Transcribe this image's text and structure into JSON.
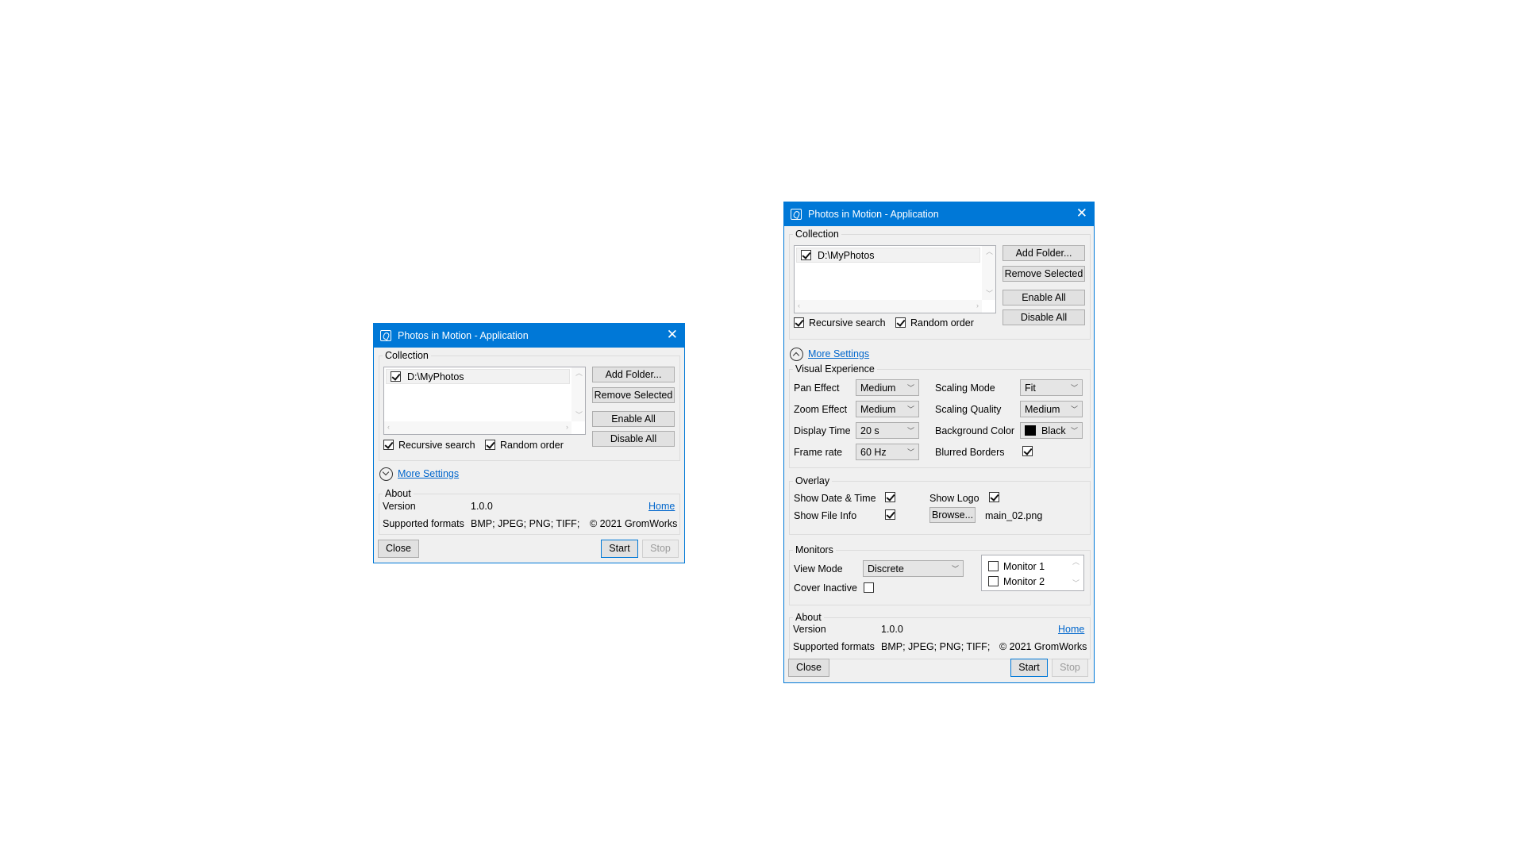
{
  "small_window": {
    "title": "Photos in Motion - Application",
    "close_glyph": "✕",
    "collection": {
      "label": "Collection",
      "folders": [
        {
          "path": "D:\\MyPhotos",
          "enabled": true
        }
      ],
      "add_folder": "Add Folder...",
      "remove_selected": "Remove Selected",
      "enable_all": "Enable All",
      "disable_all": "Disable All",
      "recursive_search": "Recursive search",
      "random_order": "Random order"
    },
    "more_settings": "More Settings",
    "about": {
      "label": "About",
      "version_label": "Version",
      "version_value": "1.0.0",
      "home_link": "Home",
      "formats_label": "Supported formats",
      "formats_value": "BMP; JPEG; PNG; TIFF;",
      "copyright": "© 2021 GromWorks"
    },
    "buttons": {
      "close": "Close",
      "start": "Start",
      "stop": "Stop"
    }
  },
  "large_window": {
    "title": "Photos in Motion - Application",
    "close_glyph": "✕",
    "collection": {
      "label": "Collection",
      "folders": [
        {
          "path": "D:\\MyPhotos",
          "enabled": true
        }
      ],
      "add_folder": "Add Folder...",
      "remove_selected": "Remove Selected",
      "enable_all": "Enable All",
      "disable_all": "Disable All",
      "recursive_search": "Recursive search",
      "random_order": "Random order"
    },
    "more_settings": "More Settings",
    "visual_experience": {
      "label": "Visual Experience",
      "pan_effect_label": "Pan Effect",
      "pan_effect_value": "Medium",
      "zoom_effect_label": "Zoom Effect",
      "zoom_effect_value": "Medium",
      "display_time_label": "Display Time",
      "display_time_value": "20 s",
      "frame_rate_label": "Frame rate",
      "frame_rate_value": "60 Hz",
      "scaling_mode_label": "Scaling Mode",
      "scaling_mode_value": "Fit",
      "scaling_quality_label": "Scaling Quality",
      "scaling_quality_value": "Medium",
      "background_color_label": "Background Color",
      "background_color_value": "Black",
      "background_color_hex": "#000000",
      "blurred_borders_label": "Blurred Borders"
    },
    "overlay": {
      "label": "Overlay",
      "show_date_time": "Show Date & Time",
      "show_file_info": "Show File Info",
      "show_logo": "Show Logo",
      "browse": "Browse...",
      "logo_file": "main_02.png"
    },
    "monitors": {
      "label": "Monitors",
      "view_mode_label": "View Mode",
      "view_mode_value": "Discrete",
      "cover_inactive_label": "Cover Inactive",
      "items": [
        "Monitor 1",
        "Monitor 2"
      ]
    },
    "about": {
      "label": "About",
      "version_label": "Version",
      "version_value": "1.0.0",
      "home_link": "Home",
      "formats_label": "Supported formats",
      "formats_value": "BMP; JPEG; PNG; TIFF;",
      "copyright": "© 2021 GromWorks"
    },
    "buttons": {
      "close": "Close",
      "start": "Start",
      "stop": "Stop"
    }
  },
  "colors": {
    "accent": "#0078d7",
    "window_bg": "#f0f0f0",
    "link": "#0066cc"
  }
}
